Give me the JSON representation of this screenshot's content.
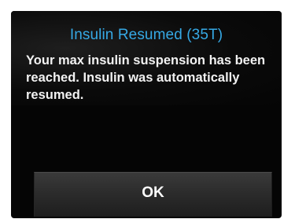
{
  "dialog": {
    "title": "Insulin Resumed (35T)",
    "message": "Your max insulin suspension has been reached. Insulin was automatically resumed.",
    "ok_label": "OK"
  },
  "colors": {
    "background": "#050505",
    "title": "#36a9e5",
    "message_text": "#f2f2f2",
    "button": "#2c2c2c",
    "button_text": "#ffffff"
  }
}
